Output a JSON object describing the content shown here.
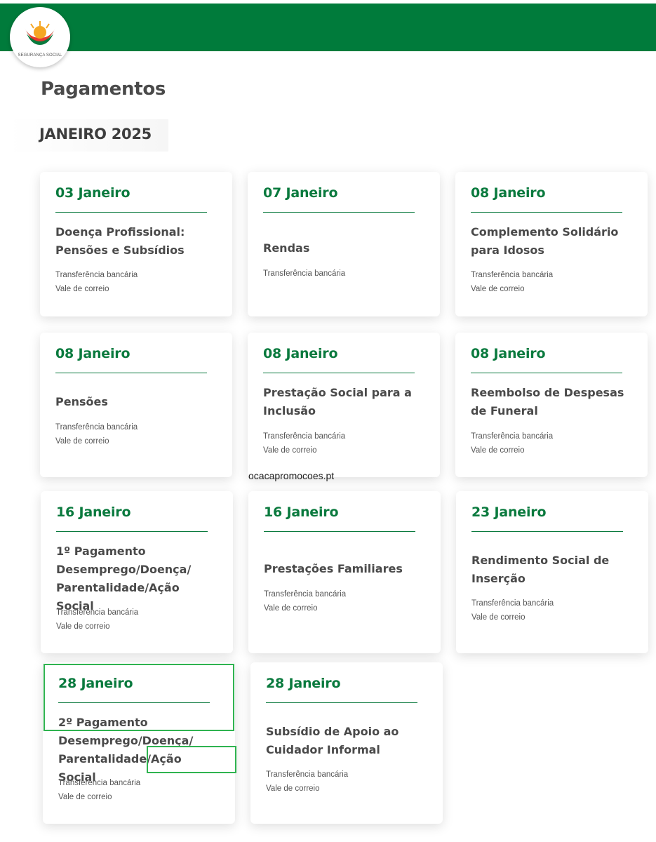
{
  "brand": {
    "logo_text": "SEGURANÇA SOCIAL",
    "primary_color": "#007b3b",
    "accent_color": "#0a7a3e",
    "highlight_color": "#2fb350"
  },
  "page": {
    "title": "Pagamentos",
    "month": "JANEIRO 2025"
  },
  "watermark": "ocacapromocoes.pt",
  "cards": [
    {
      "date": "03 Janeiro",
      "title_lines": [
        "Doença Profissional:",
        "Pensões e Subsídios"
      ],
      "methods": [
        "Transferência bancária",
        "Vale de correio"
      ]
    },
    {
      "date": "07 Janeiro",
      "title_lines": [
        "Rendas"
      ],
      "methods": [
        "Transferência bancária"
      ]
    },
    {
      "date": "08 Janeiro",
      "title_lines": [
        "Complemento Solidário",
        "para Idosos"
      ],
      "methods": [
        "Transferência bancária",
        "Vale de correio"
      ]
    },
    {
      "date": "08 Janeiro",
      "title_lines": [
        "Pensões"
      ],
      "methods": [
        "Transferência bancária",
        "Vale de correio"
      ]
    },
    {
      "date": "08 Janeiro",
      "title_lines": [
        "Prestação Social para a",
        "Inclusão"
      ],
      "methods": [
        "Transferência bancária",
        "Vale de correio"
      ]
    },
    {
      "date": "08 Janeiro",
      "title_lines": [
        "Reembolso de Despesas",
        "de Funeral"
      ],
      "methods": [
        "Transferência bancária",
        "Vale de correio"
      ]
    },
    {
      "date": "16 Janeiro",
      "title_lines": [
        "1º Pagamento",
        "Desemprego/Doença/",
        "Parentalidade/Ação Social"
      ],
      "methods": [
        "Transferência bancária",
        "Vale de correio"
      ]
    },
    {
      "date": "16 Janeiro",
      "title_lines": [
        "Prestações Familiares"
      ],
      "methods": [
        "Transferência bancária",
        "Vale de correio"
      ]
    },
    {
      "date": "23 Janeiro",
      "title_lines": [
        "Rendimento Social de",
        "Inserção"
      ],
      "methods": [
        "Transferência bancária",
        "Vale de correio"
      ]
    },
    {
      "date": "28 Janeiro",
      "title_lines": [
        "2º Pagamento",
        "Desemprego/Doença/",
        "Parentalidade/Ação Social"
      ],
      "methods": [
        "Transferência bancária",
        "Vale de correio"
      ]
    },
    {
      "date": "28 Janeiro",
      "title_lines": [
        "Subsídio de Apoio ao",
        "Cuidador Informal"
      ],
      "methods": [
        "Transferência bancária",
        "Vale de correio"
      ]
    }
  ]
}
